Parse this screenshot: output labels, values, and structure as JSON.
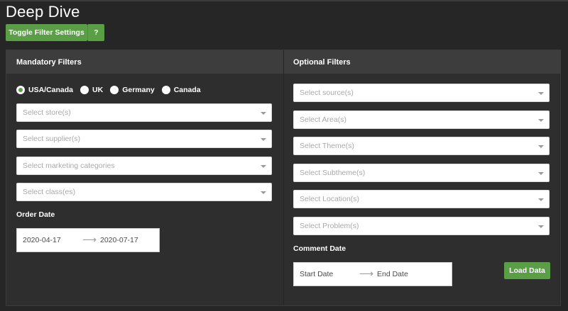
{
  "app": {
    "title": "Deep Dive"
  },
  "toolbar": {
    "toggle_label": "Toggle Filter Settings",
    "help_label": "?"
  },
  "mandatory": {
    "header": "Mandatory Filters",
    "regions": [
      {
        "label": "USA/Canada",
        "checked": true
      },
      {
        "label": "UK",
        "checked": false
      },
      {
        "label": "Germany",
        "checked": false
      },
      {
        "label": "Canada",
        "checked": false
      }
    ],
    "selects": [
      {
        "placeholder": "Select store(s)"
      },
      {
        "placeholder": "Select supplier(s)"
      },
      {
        "placeholder": "Select marketing categories"
      },
      {
        "placeholder": "Select class(es)"
      }
    ],
    "order_date": {
      "label": "Order Date",
      "start": "2020-04-17",
      "end": "2020-07-17",
      "arrow": "⟶"
    }
  },
  "optional": {
    "header": "Optional Filters",
    "selects": [
      {
        "placeholder": "Select source(s)"
      },
      {
        "placeholder": "Select Area(s)"
      },
      {
        "placeholder": "Select Theme(s)"
      },
      {
        "placeholder": "Select Subtheme(s)"
      },
      {
        "placeholder": "Select Location(s)"
      },
      {
        "placeholder": "Select Problem(s)"
      }
    ],
    "comment_date": {
      "label": "Comment Date",
      "start": "Start Date",
      "end": "End Date",
      "arrow": "⟶"
    },
    "load_label": "Load Data"
  },
  "colors": {
    "accent": "#5a9e45",
    "background": "#262626",
    "panel": "#2e2e2e",
    "header": "#3d3d3d"
  }
}
